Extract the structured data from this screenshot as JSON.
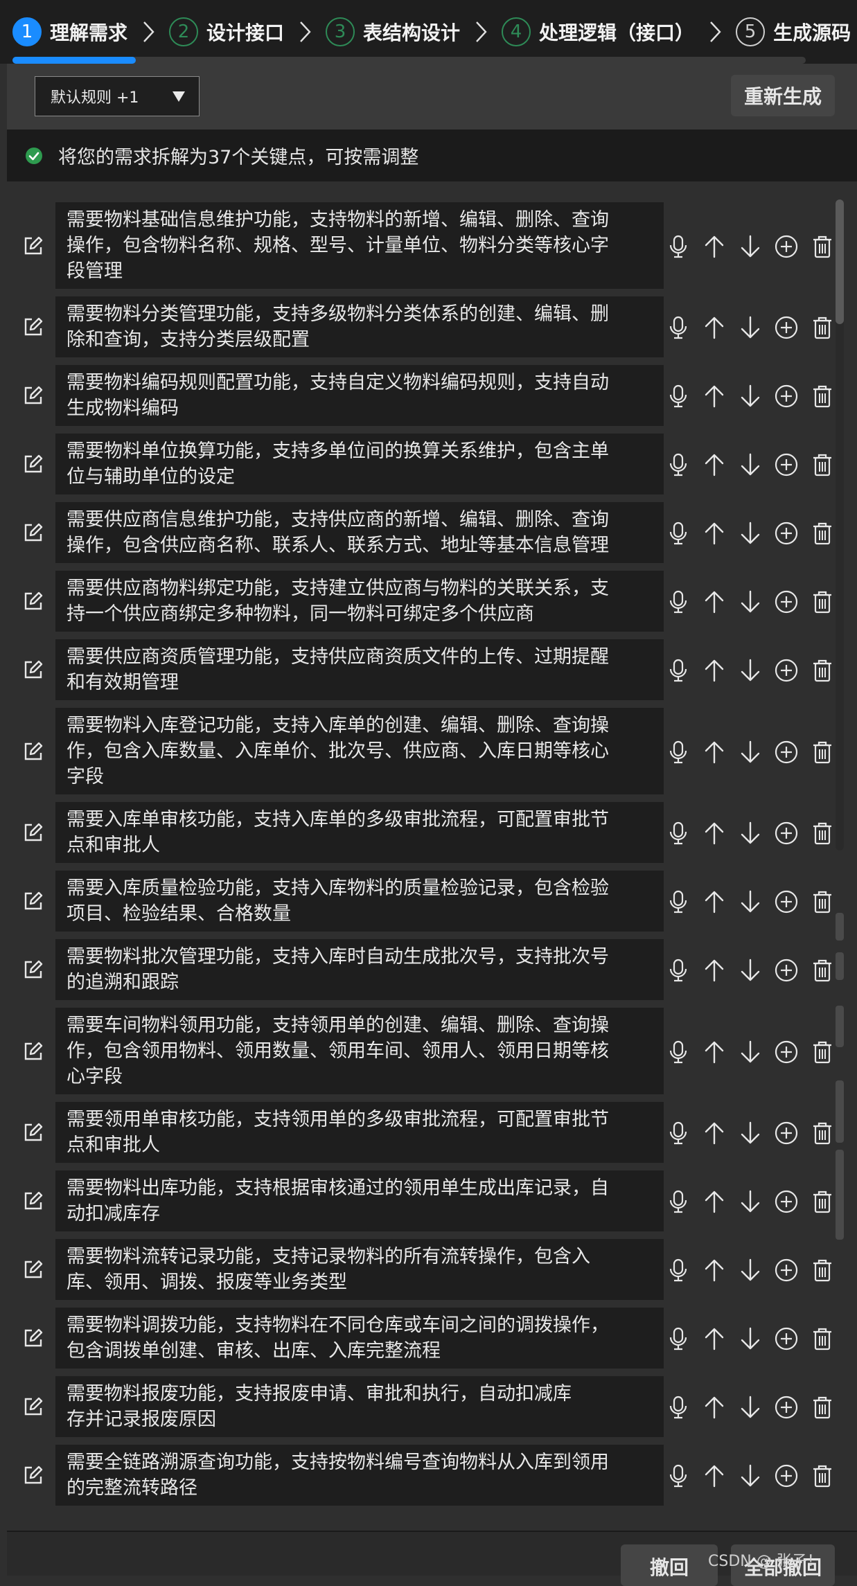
{
  "steps": [
    {
      "number": "1",
      "label": "理解需求",
      "state": "active"
    },
    {
      "number": "2",
      "label": "设计接口",
      "state": "done"
    },
    {
      "number": "3",
      "label": "表结构设计",
      "state": "done"
    },
    {
      "number": "4",
      "label": "处理逻辑（接口）",
      "state": "done"
    },
    {
      "number": "5",
      "label": "生成源码",
      "state": "future"
    }
  ],
  "toolbar": {
    "rule_select_value": "默认规则 +1",
    "regenerate_label": "重新生成"
  },
  "info": {
    "message": "将您的需求拆解为37个关键点，可按需调整",
    "status_color": "#2e9b4f"
  },
  "requirements": [
    {
      "lines": [
        "需要物料基础信息维护功能，支持物料的新增、编辑、删除、查询",
        "操作，包含物料名称、规格、型号、计量单位、物料分类等核心字",
        "段管理"
      ]
    },
    {
      "lines": [
        "需要物料分类管理功能，支持多级物料分类体系的创建、编辑、删",
        "除和查询，支持分类层级配置"
      ]
    },
    {
      "lines": [
        "需要物料编码规则配置功能，支持自定义物料编码规则，支持自动",
        "生成物料编码"
      ]
    },
    {
      "lines": [
        "需要物料单位换算功能，支持多单位间的换算关系维护，包含主单",
        "位与辅助单位的设定"
      ]
    },
    {
      "lines": [
        "需要供应商信息维护功能，支持供应商的新增、编辑、删除、查询",
        "操作，包含供应商名称、联系人、联系方式、地址等基本信息管理"
      ]
    },
    {
      "lines": [
        "需要供应商物料绑定功能，支持建立供应商与物料的关联关系，支",
        "持一个供应商绑定多种物料，同一物料可绑定多个供应商"
      ]
    },
    {
      "lines": [
        "需要供应商资质管理功能，支持供应商资质文件的上传、过期提醒",
        "和有效期管理"
      ]
    },
    {
      "lines": [
        "需要物料入库登记功能，支持入库单的创建、编辑、删除、查询操",
        "作，包含入库数量、入库单价、批次号、供应商、入库日期等核心",
        "字段"
      ]
    },
    {
      "lines": [
        "需要入库单审核功能，支持入库单的多级审批流程，可配置审批节",
        "点和审批人"
      ]
    },
    {
      "lines": [
        "需要入库质量检验功能，支持入库物料的质量检验记录，包含检验",
        "项目、检验结果、合格数量"
      ]
    },
    {
      "lines": [
        "需要物料批次管理功能，支持入库时自动生成批次号，支持批次号",
        "的追溯和跟踪"
      ]
    },
    {
      "lines": [
        "需要车间物料领用功能，支持领用单的创建、编辑、删除、查询操",
        "作，包含领用物料、领用数量、领用车间、领用人、领用日期等核",
        "心字段"
      ]
    },
    {
      "lines": [
        "需要领用单审核功能，支持领用单的多级审批流程，可配置审批节",
        "点和审批人"
      ]
    },
    {
      "lines": [
        "需要物料出库功能，支持根据审核通过的领用单生成出库记录，自",
        "动扣减库存"
      ]
    },
    {
      "lines": [
        "需要物料流转记录功能，支持记录物料的所有流转操作，包含入",
        "库、领用、调拨、报废等业务类型"
      ]
    },
    {
      "lines": [
        "需要物料调拨功能，支持物料在不同仓库或车间之间的调拨操作，",
        "包含调拨单创建、审核、出库、入库完整流程"
      ]
    },
    {
      "lines": [
        "需要物料报废功能，支持报废申请、审批和执行，自动扣减库",
        "存并记录报废原因"
      ]
    },
    {
      "lines": [
        "需要全链路溯源查询功能，支持按物料编号查询物料从入库到领用",
        "的完整流转路径"
      ]
    }
  ],
  "bottom": {
    "revoke_label": "撤回",
    "revoke_all_label": "全部撤回",
    "watermark": "CSDN @ 张子！"
  },
  "colors": {
    "accent": "#1a8cff",
    "step_done": "#2e8b57",
    "background": "#2f2f2f"
  }
}
